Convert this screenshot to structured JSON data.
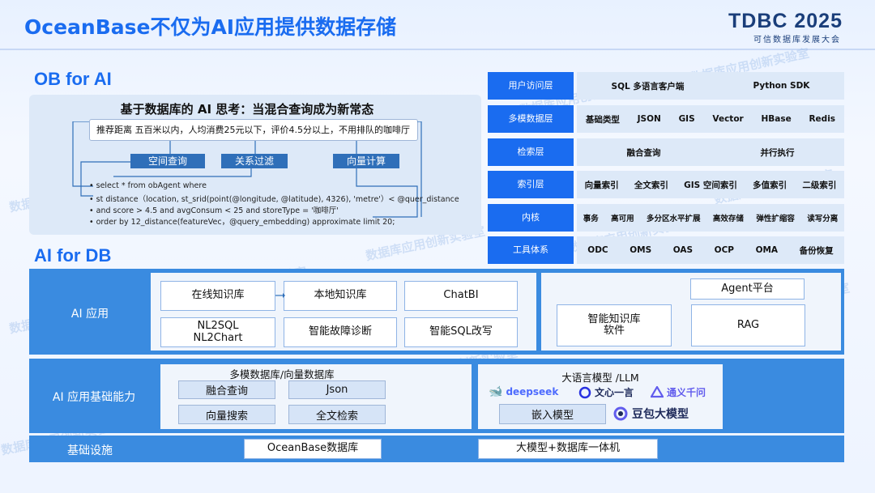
{
  "header": {
    "title": "OceanBase不仅为AI应用提供数据存储",
    "logo_main": "TDBC 2025",
    "logo_sub": "可信数据库发展大会"
  },
  "watermark": "数据库应用创新实验室",
  "ob_for_ai": {
    "section_title": "OB for AI",
    "heading": "基于数据库的 AI 思考：当混合查询成为新常态",
    "query_text": "推荐距离 五百米以内，人均消费25元以下，评价4.5分以上，不用排队的咖啡厅",
    "buttons": [
      "空间查询",
      "关系过滤",
      "向量计算"
    ],
    "code_lines": [
      "• select * from obAgent where",
      "• st distance（location, st_srid(point(@longitude, @latitude), 4326), 'metre'）< @quer_distance",
      "• and score > 4.5 and avgConsum < 25 and storeType = '咖啡厅'",
      "• order by 12_distance(featureVec，@query_embedding) approximate limit 20;"
    ]
  },
  "stack": [
    {
      "label": "用户访问层",
      "items": [
        "SQL 多语言客户端",
        "Python SDK"
      ]
    },
    {
      "label": "多模数据层",
      "items": [
        "基础类型",
        "JSON",
        "GIS",
        "Vector",
        "HBase",
        "Redis"
      ]
    },
    {
      "label": "检索层",
      "items": [
        "融合查询",
        "并行执行"
      ]
    },
    {
      "label": "索引层",
      "items": [
        "向量索引",
        "全文索引",
        "GIS 空间索引",
        "多值索引",
        "二级索引"
      ]
    },
    {
      "label": "内核",
      "items": [
        "事务",
        "高可用",
        "多分区水平扩展",
        "高效存储",
        "弹性扩缩容",
        "读写分离"
      ]
    },
    {
      "label": "工具体系",
      "items": [
        "ODC",
        "OMS",
        "OAS",
        "OCP",
        "OMA",
        "备份恢复"
      ]
    }
  ],
  "ai_for_db": {
    "section_title": "AI for DB",
    "ai_app": {
      "label": "AI 应用",
      "boxes": [
        "在线知识库",
        "本地知识库",
        "ChatBI",
        "NL2SQL\nNL2Chart",
        "智能故障诊断",
        "智能SQL改写"
      ],
      "right_boxes": [
        "Agent平台",
        "智能知识库\n软件",
        "RAG"
      ]
    },
    "ai_base": {
      "label": "AI 应用基础能力",
      "db_title": "多模数据库/向量数据库",
      "db_items": [
        "融合查询",
        "Json",
        "向量搜索",
        "全文检索"
      ],
      "llm_title": "大语言模型 /LLM",
      "llm_logos": [
        "deepseek",
        "文心一言",
        "通义千问"
      ],
      "embed_label": "嵌入模型",
      "doubao": "豆包大模型"
    },
    "infra": {
      "label": "基础设施",
      "items": [
        "OceanBase数据库",
        "大模型+数据库一体机"
      ]
    }
  },
  "colors": {
    "accent": "#1a6cf0",
    "band": "#3a8be0",
    "panel": "#dde9f8",
    "deepseek": "#4d6bfe",
    "wenxin": "#2932e1",
    "tongyi": "#615ced",
    "doubao": "#1e2a5a"
  }
}
